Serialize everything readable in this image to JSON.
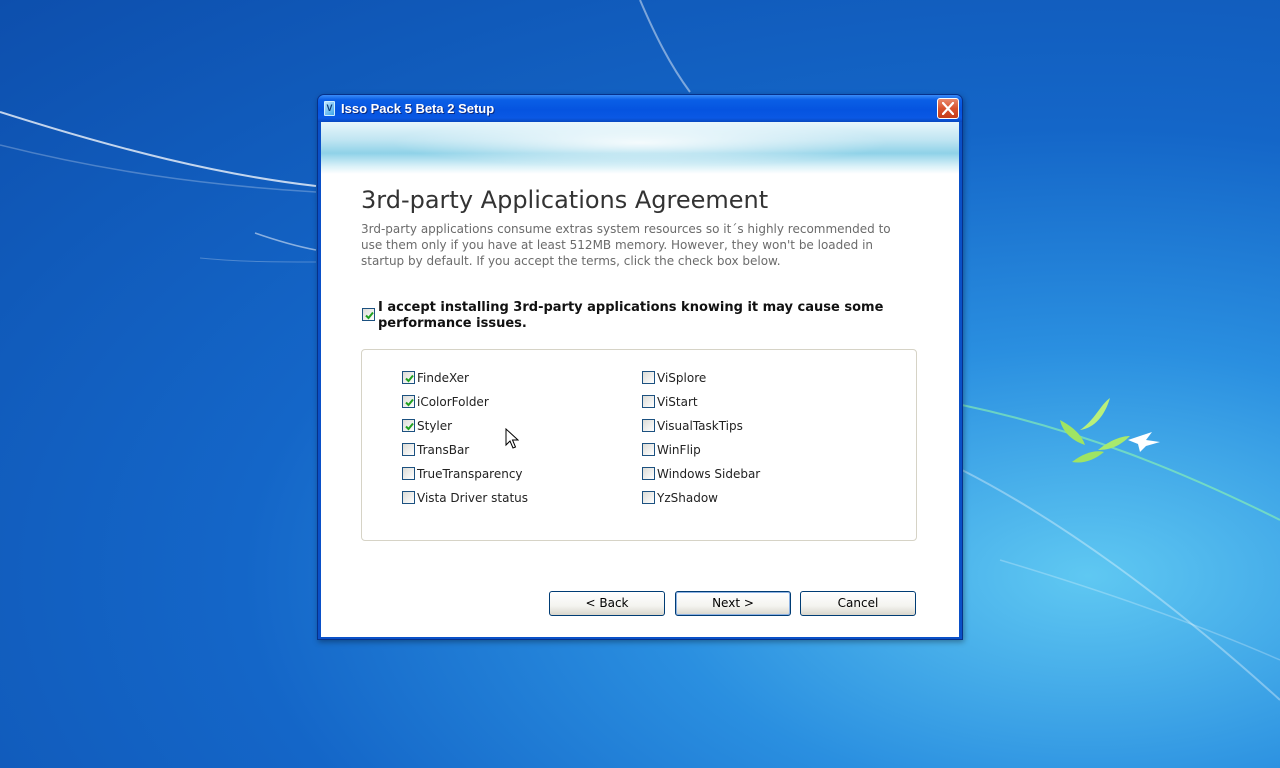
{
  "window": {
    "title": "Isso Pack 5 Beta 2 Setup",
    "icon": "setup-icon"
  },
  "page": {
    "heading": "3rd-party Applications Agreement",
    "description": "3rd-party applications consume extras system resources so it´s highly recommended to use them only if you have at least 512MB memory. However, they won't be loaded in startup by default. If you accept the terms, click the check box below."
  },
  "accept": {
    "label": "I accept installing 3rd-party applications knowing it may cause some performance issues.",
    "checked": true
  },
  "apps": {
    "left": [
      {
        "label": "FindeXer",
        "checked": true
      },
      {
        "label": "iColorFolder",
        "checked": true
      },
      {
        "label": "Styler",
        "checked": true
      },
      {
        "label": "TransBar",
        "checked": false
      },
      {
        "label": "TrueTransparency",
        "checked": false
      },
      {
        "label": "Vista Driver status",
        "checked": false
      }
    ],
    "right": [
      {
        "label": "ViSplore",
        "checked": false
      },
      {
        "label": "ViStart",
        "checked": false
      },
      {
        "label": "VisualTaskTips",
        "checked": false
      },
      {
        "label": "WinFlip",
        "checked": false
      },
      {
        "label": "Windows Sidebar",
        "checked": false
      },
      {
        "label": "YzShadow",
        "checked": false
      }
    ]
  },
  "buttons": {
    "back": "< Back",
    "next": "Next >",
    "cancel": "Cancel"
  },
  "colors": {
    "titlebar": "#0554e0",
    "desktop": "#1466c8",
    "checkmark": "#21a121"
  }
}
